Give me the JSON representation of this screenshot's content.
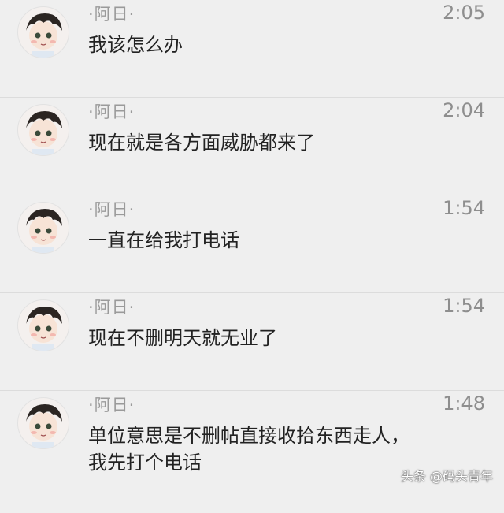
{
  "messages": [
    {
      "sender": "·阿日·",
      "time": "2:05",
      "text": "我该怎么办"
    },
    {
      "sender": "·阿日·",
      "time": "2:04",
      "text": "现在就是各方面威胁都来了"
    },
    {
      "sender": "·阿日·",
      "time": "1:54",
      "text": "一直在给我打电话"
    },
    {
      "sender": "·阿日·",
      "time": "1:54",
      "text": "现在不删明天就无业了"
    },
    {
      "sender": "·阿日·",
      "time": "1:48",
      "text": "单位意思是不删帖直接收拾东西走人，\n我先打个电话"
    }
  ],
  "watermark": "头条 @码头青年",
  "avatar_icon": "anime-boy-avatar-icon"
}
